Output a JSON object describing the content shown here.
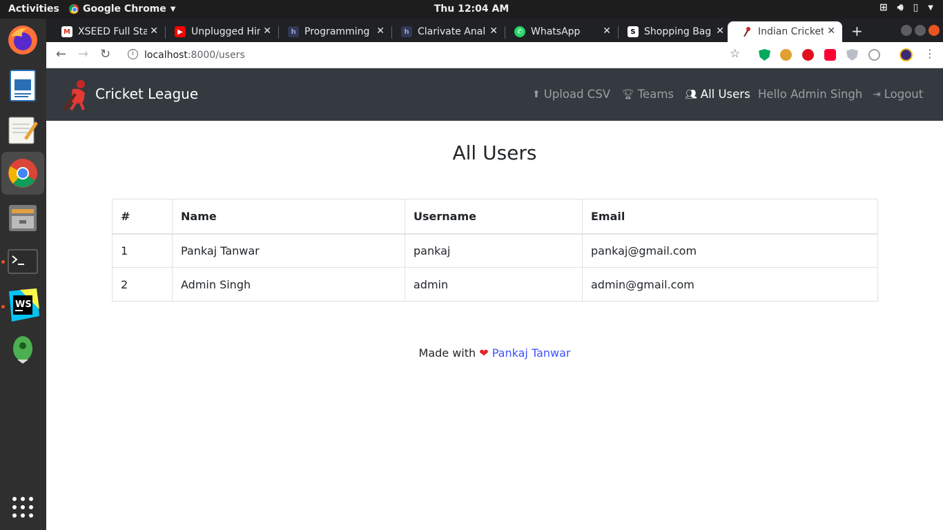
{
  "system": {
    "activities": "Activities",
    "app_menu": "Google Chrome",
    "clock": "Thu 12:04 AM"
  },
  "browser": {
    "tabs": [
      {
        "title": "XSEED Full Sta",
        "favicon": "gmail-icon"
      },
      {
        "title": "Unplugged Hir",
        "favicon": "youtube-icon"
      },
      {
        "title": "Programming",
        "favicon": "hackerearth-icon"
      },
      {
        "title": "Clarivate Anal",
        "favicon": "hackerearth-icon"
      },
      {
        "title": "WhatsApp",
        "favicon": "whatsapp-icon"
      },
      {
        "title": "Shopping Bag",
        "favicon": "s-icon"
      },
      {
        "title": "Indian Cricket",
        "favicon": "cricket-icon"
      }
    ],
    "active_tab": 6,
    "url_host": "localhost",
    "url_rest": ":8000/users"
  },
  "navbar": {
    "brand": "Cricket League",
    "links": [
      {
        "label": "Upload CSV",
        "icon": "upload-icon"
      },
      {
        "label": "Teams",
        "icon": "trophy-icon"
      },
      {
        "label": "All Users",
        "icon": "users-icon"
      },
      {
        "label": "Hello Admin Singh",
        "icon": ""
      },
      {
        "label": "Logout",
        "icon": "logout-icon"
      }
    ]
  },
  "main": {
    "heading": "All Users",
    "table": {
      "headers": [
        "#",
        "Name",
        "Username",
        "Email"
      ],
      "rows": [
        [
          "1",
          "Pankaj Tanwar",
          "pankaj",
          "pankaj@gmail.com"
        ],
        [
          "2",
          "Admin Singh",
          "admin",
          "admin@gmail.com"
        ]
      ]
    }
  },
  "footer": {
    "prefix": "Made with",
    "heart": "❤",
    "author": "Pankaj Tanwar"
  },
  "colors": {
    "navbar_bg": "#343a40",
    "link": "#3f51ff",
    "heart": "#e3242b"
  }
}
